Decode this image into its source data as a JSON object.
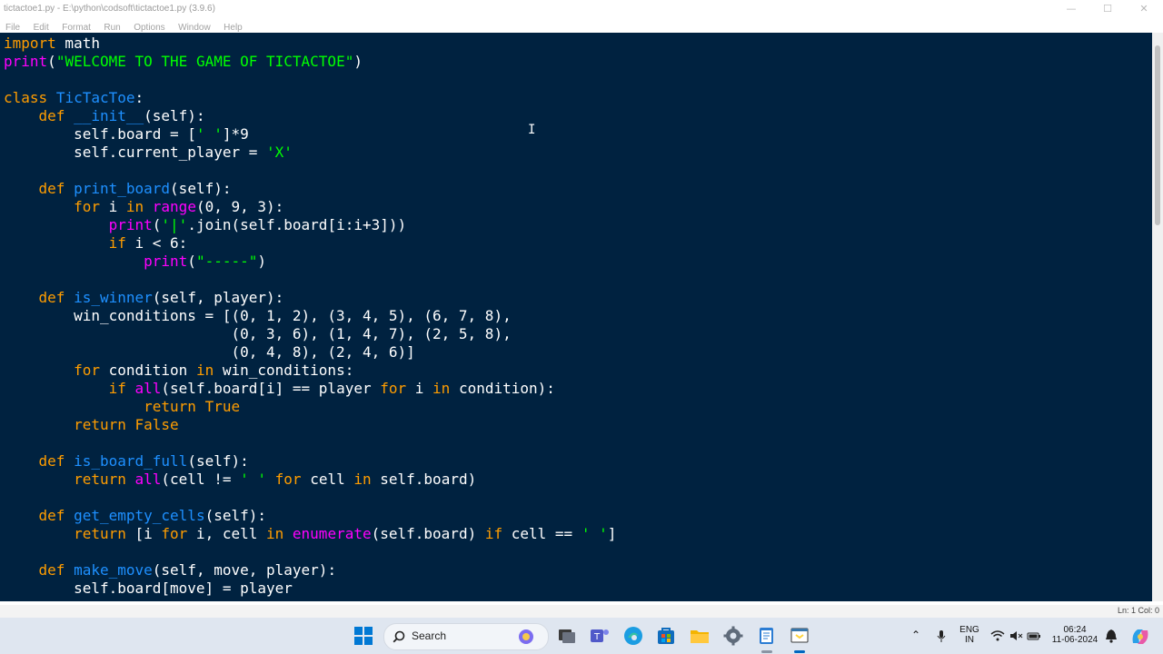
{
  "window": {
    "title": "tictactoe1.py - E:\\python\\codsoft\\tictactoe1.py (3.9.6)",
    "minimize_glyph": "—",
    "maximize_glyph": "☐",
    "close_glyph": "✕"
  },
  "menu": [
    "File",
    "Edit",
    "Format",
    "Run",
    "Options",
    "Window",
    "Help"
  ],
  "editor": {
    "background": "#002240",
    "colors": {
      "keyword": "#ff9d00",
      "builtin": "#ff00ff",
      "string": "#00ff00",
      "definition": "#1e90ff",
      "text": "#ffffff"
    },
    "lines": [
      [
        [
          "kw",
          "import"
        ],
        [
          "t",
          " math"
        ]
      ],
      [
        [
          "bi",
          "print"
        ],
        [
          "t",
          "("
        ],
        [
          "st",
          "\"WELCOME TO THE GAME OF TICTACTOE\""
        ],
        [
          "t",
          ")"
        ]
      ],
      [],
      [
        [
          "kw",
          "class"
        ],
        [
          "t",
          " "
        ],
        [
          "fn",
          "TicTacToe"
        ],
        [
          "t",
          ":"
        ]
      ],
      [
        [
          "t",
          "    "
        ],
        [
          "kw",
          "def"
        ],
        [
          "t",
          " "
        ],
        [
          "fn",
          "__init__"
        ],
        [
          "t",
          "(self):"
        ]
      ],
      [
        [
          "t",
          "        self.board = ["
        ],
        [
          "st",
          "' '"
        ],
        [
          "t",
          "]*9"
        ]
      ],
      [
        [
          "t",
          "        self.current_player = "
        ],
        [
          "st",
          "'X'"
        ]
      ],
      [],
      [
        [
          "t",
          "    "
        ],
        [
          "kw",
          "def"
        ],
        [
          "t",
          " "
        ],
        [
          "fn",
          "print_board"
        ],
        [
          "t",
          "(self):"
        ]
      ],
      [
        [
          "t",
          "        "
        ],
        [
          "kw",
          "for"
        ],
        [
          "t",
          " i "
        ],
        [
          "kw",
          "in"
        ],
        [
          "t",
          " "
        ],
        [
          "bi",
          "range"
        ],
        [
          "t",
          "(0, 9, 3):"
        ]
      ],
      [
        [
          "t",
          "            "
        ],
        [
          "bi",
          "print"
        ],
        [
          "t",
          "("
        ],
        [
          "st",
          "'|'"
        ],
        [
          "t",
          ".join(self.board[i:i+3]))"
        ]
      ],
      [
        [
          "t",
          "            "
        ],
        [
          "kw",
          "if"
        ],
        [
          "t",
          " i < 6:"
        ]
      ],
      [
        [
          "t",
          "                "
        ],
        [
          "bi",
          "print"
        ],
        [
          "t",
          "("
        ],
        [
          "st",
          "\"-----\""
        ],
        [
          "t",
          ")"
        ]
      ],
      [],
      [
        [
          "t",
          "    "
        ],
        [
          "kw",
          "def"
        ],
        [
          "t",
          " "
        ],
        [
          "fn",
          "is_winner"
        ],
        [
          "t",
          "(self, player):"
        ]
      ],
      [
        [
          "t",
          "        win_conditions = [(0, 1, 2), (3, 4, 5), (6, 7, 8),"
        ]
      ],
      [
        [
          "t",
          "                          (0, 3, 6), (1, 4, 7), (2, 5, 8),"
        ]
      ],
      [
        [
          "t",
          "                          (0, 4, 8), (2, 4, 6)]"
        ]
      ],
      [
        [
          "t",
          "        "
        ],
        [
          "kw",
          "for"
        ],
        [
          "t",
          " condition "
        ],
        [
          "kw",
          "in"
        ],
        [
          "t",
          " win_conditions:"
        ]
      ],
      [
        [
          "t",
          "            "
        ],
        [
          "kw",
          "if"
        ],
        [
          "t",
          " "
        ],
        [
          "bi",
          "all"
        ],
        [
          "t",
          "(self.board[i] == player "
        ],
        [
          "kw",
          "for"
        ],
        [
          "t",
          " i "
        ],
        [
          "kw",
          "in"
        ],
        [
          "t",
          " condition):"
        ]
      ],
      [
        [
          "t",
          "                "
        ],
        [
          "kw",
          "return"
        ],
        [
          "t",
          " "
        ],
        [
          "kw",
          "True"
        ]
      ],
      [
        [
          "t",
          "        "
        ],
        [
          "kw",
          "return"
        ],
        [
          "t",
          " "
        ],
        [
          "kw",
          "False"
        ]
      ],
      [],
      [
        [
          "t",
          "    "
        ],
        [
          "kw",
          "def"
        ],
        [
          "t",
          " "
        ],
        [
          "fn",
          "is_board_full"
        ],
        [
          "t",
          "(self):"
        ]
      ],
      [
        [
          "t",
          "        "
        ],
        [
          "kw",
          "return"
        ],
        [
          "t",
          " "
        ],
        [
          "bi",
          "all"
        ],
        [
          "t",
          "(cell != "
        ],
        [
          "st",
          "' '"
        ],
        [
          "t",
          " "
        ],
        [
          "kw",
          "for"
        ],
        [
          "t",
          " cell "
        ],
        [
          "kw",
          "in"
        ],
        [
          "t",
          " self.board)"
        ]
      ],
      [],
      [
        [
          "t",
          "    "
        ],
        [
          "kw",
          "def"
        ],
        [
          "t",
          " "
        ],
        [
          "fn",
          "get_empty_cells"
        ],
        [
          "t",
          "(self):"
        ]
      ],
      [
        [
          "t",
          "        "
        ],
        [
          "kw",
          "return"
        ],
        [
          "t",
          " [i "
        ],
        [
          "kw",
          "for"
        ],
        [
          "t",
          " i, cell "
        ],
        [
          "kw",
          "in"
        ],
        [
          "t",
          " "
        ],
        [
          "bi",
          "enumerate"
        ],
        [
          "t",
          "(self.board) "
        ],
        [
          "kw",
          "if"
        ],
        [
          "t",
          " cell == "
        ],
        [
          "st",
          "' '"
        ],
        [
          "t",
          "]"
        ]
      ],
      [],
      [
        [
          "t",
          "    "
        ],
        [
          "kw",
          "def"
        ],
        [
          "t",
          " "
        ],
        [
          "fn",
          "make_move"
        ],
        [
          "t",
          "(self, move, player):"
        ]
      ],
      [
        [
          "t",
          "        self.board[move] = player"
        ]
      ]
    ]
  },
  "status": {
    "position": "Ln: 1   Col: 0"
  },
  "taskbar": {
    "search_label": "Search",
    "lang_line1": "ENG",
    "lang_line2": "IN",
    "time": "06:24",
    "date": "11-06-2024"
  }
}
